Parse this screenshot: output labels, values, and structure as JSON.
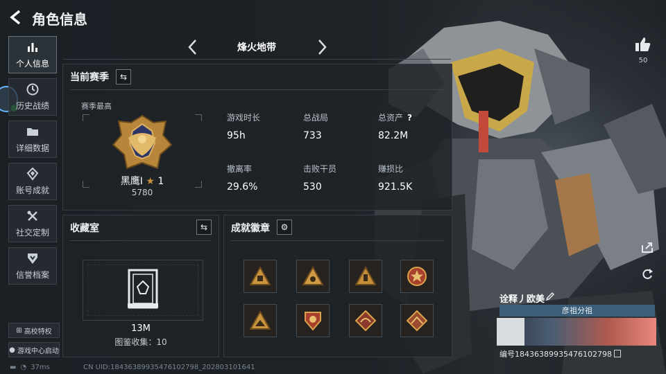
{
  "header": {
    "title": "角色信息"
  },
  "nav": {
    "items": [
      {
        "label": "个人信息",
        "icon": "bar-chart-icon",
        "active": true
      },
      {
        "label": "历史战绩",
        "icon": "clock-icon"
      },
      {
        "label": "详细数据",
        "icon": "folder-icon"
      },
      {
        "label": "账号成就",
        "icon": "medal-icon"
      },
      {
        "label": "社交定制",
        "icon": "tools-icon"
      },
      {
        "label": "信誉档案",
        "icon": "shield-icon"
      }
    ],
    "campus_label": "高校特权",
    "game_center_label": "游戏中心启动"
  },
  "map_selector": {
    "current": "烽火地带"
  },
  "season": {
    "title": "当前赛季",
    "subtitle": "赛季最高",
    "rank_name": "黑鹰Ⅰ",
    "rank_star": "1",
    "rank_score": "5780",
    "stats": [
      {
        "label": "游戏时长",
        "value": "95h"
      },
      {
        "label": "总战局",
        "value": "733"
      },
      {
        "label": "总资产",
        "value": "82.2M",
        "help": "?"
      },
      {
        "label": "撤离率",
        "value": "29.6%"
      },
      {
        "label": "击败干员",
        "value": "530"
      },
      {
        "label": "赚损比",
        "value": "921.5K"
      }
    ]
  },
  "collection": {
    "title": "收藏室",
    "value": "13M",
    "count_label": "图鉴收集：10"
  },
  "achievements": {
    "title": "成就徽章"
  },
  "likes": {
    "count": "50"
  },
  "player": {
    "name": "诠释丿欧美",
    "guild": "彦祖分祖",
    "id": "编号18436389935476102798"
  },
  "status": {
    "ping": "37ms"
  },
  "footer": {
    "uid": "CN UID:18436389935476102798_202803101641"
  },
  "colors": {
    "accent": "#3c6079",
    "gold": "#c9923f",
    "online": "#2fbf4f"
  }
}
